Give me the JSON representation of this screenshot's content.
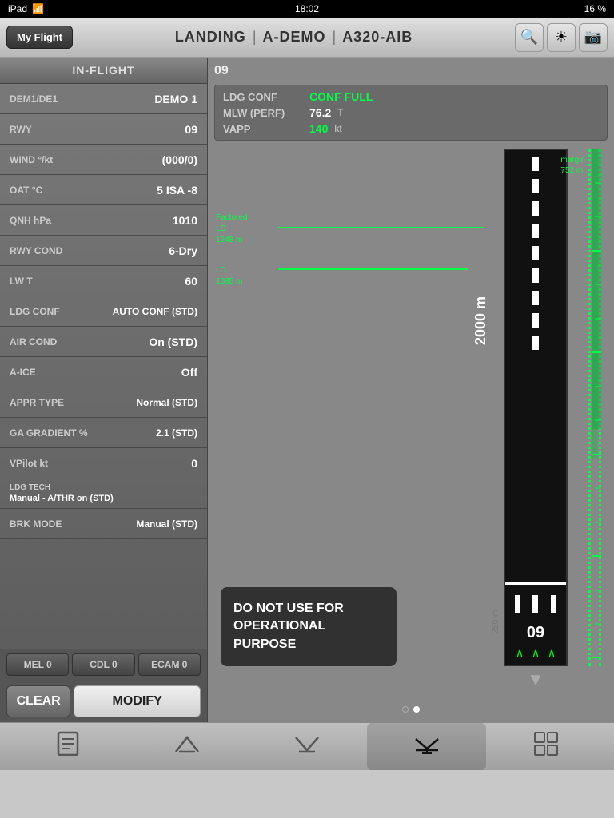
{
  "status_bar": {
    "device": "iPad",
    "wifi_icon": "wifi",
    "time": "18:02",
    "battery": "16 %"
  },
  "nav_bar": {
    "my_flight_label": "My Flight",
    "segment1": "LANDING",
    "segment2": "A-DEMO",
    "segment3": "A320-AIB",
    "search_icon": "search",
    "brightness_icon": "brightness",
    "camera_icon": "camera"
  },
  "left_panel": {
    "header": "IN-FLIGHT",
    "params": [
      {
        "label": "DEM1/DE1",
        "value": "DEMO 1"
      },
      {
        "label": "RWY",
        "value": "09"
      },
      {
        "label": "WIND  °/kt",
        "value": "(000/0)"
      },
      {
        "label": "OAT °C",
        "value": "5 ISA -8"
      },
      {
        "label": "QNH  hPa",
        "value": "1010"
      },
      {
        "label": "RWY COND",
        "value": "6-Dry"
      }
    ],
    "params2": [
      {
        "label": "LW  T",
        "value": "60"
      },
      {
        "label": "LDG CONF",
        "label2": "AUTO CONF (STD)"
      },
      {
        "label": "AIR COND",
        "value": "On (STD)"
      },
      {
        "label": "A-ICE",
        "value": "Off"
      },
      {
        "label": "APPR TYPE",
        "value": "Normal (STD)"
      },
      {
        "label": "GA GRADIENT %",
        "value": "2.1 (STD)"
      },
      {
        "label": "VPilot  kt",
        "value": "0"
      }
    ],
    "params3": [
      {
        "label": "LDG TECH",
        "value": "Manual - A/THR on (STD)"
      },
      {
        "label": "BRK MODE",
        "value": "Manual (STD)"
      }
    ],
    "mel_label": "MEL 0",
    "cdl_label": "CDL 0",
    "ecam_label": "ECAM 0",
    "clear_label": "CLEAR",
    "modify_label": "MODIFY"
  },
  "right_panel": {
    "runway_id": "09",
    "perf": [
      {
        "label": "LDG CONF",
        "value": "CONF FULL",
        "color": "green",
        "unit": ""
      },
      {
        "label": "MLW (PERF)",
        "value": "76.2",
        "color": "white",
        "unit": "T"
      },
      {
        "label": "VAPP",
        "value": "140",
        "color": "green",
        "unit": "kt"
      }
    ],
    "factored_ld_label": "Factored",
    "factored_ld_label2": "LD",
    "factored_ld_value": "1248 m",
    "ld_label": "LD",
    "ld_value": "1085 m",
    "marker_2000": "2000 m",
    "margin_label": "margin",
    "margin_value": "752 m",
    "marker_250": "250 m",
    "warning_text": "DO NOT USE FOR\nOPERATIONAL PURPOSE",
    "runway_number_end": "09",
    "pagination": {
      "total": 2,
      "active": 1
    }
  },
  "tab_bar": {
    "tabs": [
      {
        "icon": "✈",
        "name": "tab-briefing",
        "active": false
      },
      {
        "icon": "✈",
        "name": "tab-takeoff",
        "active": false
      },
      {
        "icon": "✈",
        "name": "tab-approach",
        "active": false
      },
      {
        "icon": "✈",
        "name": "tab-landing",
        "active": true
      },
      {
        "icon": "▦",
        "name": "tab-misc",
        "active": false
      }
    ]
  }
}
